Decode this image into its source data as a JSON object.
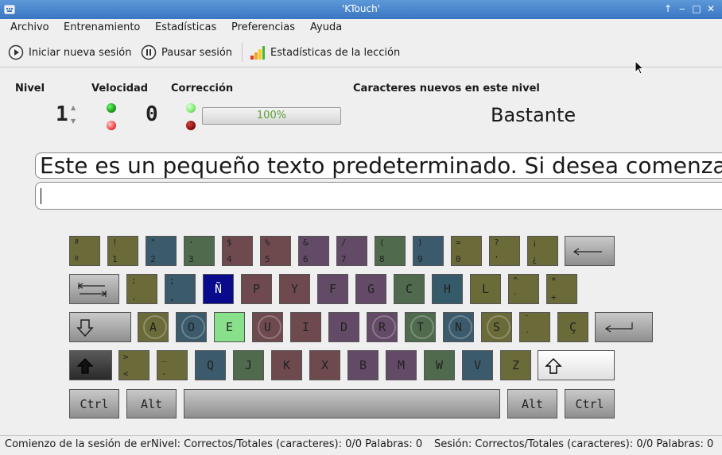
{
  "window": {
    "title": "'KTouch'"
  },
  "menu": [
    {
      "label": "Archivo"
    },
    {
      "label": "Entrenamiento"
    },
    {
      "label": "Estadísticas"
    },
    {
      "label": "Preferencias"
    },
    {
      "label": "Ayuda"
    }
  ],
  "toolbar": {
    "new_session": "Iniciar nueva sesión",
    "pause_session": "Pausar sesión",
    "lesson_stats": "Estadísticas de la lección"
  },
  "stats": {
    "level_label": "Nivel",
    "level_value": "1",
    "speed_label": "Velocidad",
    "speed_value": "0",
    "correction_label": "Corrección",
    "correction_percent": "100%",
    "new_chars_label": "Caracteres nuevos en este nivel",
    "new_chars_value": "Bastante",
    "colors": {
      "led_green": "#1f9a1f",
      "led_red": "#e44",
      "led_light_green": "#7dea6e",
      "led_dark_red": "#8a1010"
    }
  },
  "text": {
    "teacher_line": "Este es un pequeño texto predeterminado. Si desea comenzar",
    "student_line": ""
  },
  "keyboard": {
    "row1": [
      {
        "top": "ª",
        "bottom": "º"
      },
      {
        "top": "!",
        "bottom": "1"
      },
      {
        "top": "\"",
        "bottom": "2"
      },
      {
        "top": "·",
        "bottom": "3"
      },
      {
        "top": "$",
        "bottom": "4"
      },
      {
        "top": "%",
        "bottom": "5"
      },
      {
        "top": "&",
        "bottom": "6"
      },
      {
        "top": "/",
        "bottom": "7"
      },
      {
        "top": "(",
        "bottom": "8"
      },
      {
        "top": ")",
        "bottom": "9"
      },
      {
        "top": "=",
        "bottom": "0"
      },
      {
        "top": "?",
        "bottom": "'"
      },
      {
        "top": "¡",
        "bottom": "¿"
      }
    ],
    "row2": [
      {
        "top": ":",
        "bottom": "."
      },
      {
        "top": ";",
        "bottom": ","
      },
      {
        "main": "Ñ"
      },
      {
        "main": "P"
      },
      {
        "main": "Y"
      },
      {
        "main": "F"
      },
      {
        "main": "G"
      },
      {
        "main": "C"
      },
      {
        "main": "H"
      },
      {
        "main": "L"
      },
      {
        "top": "^",
        "bottom": "`"
      },
      {
        "top": "*",
        "bottom": "+"
      }
    ],
    "row3": [
      {
        "main": "A"
      },
      {
        "main": "O"
      },
      {
        "main": "E"
      },
      {
        "main": "U"
      },
      {
        "main": "I"
      },
      {
        "main": "D"
      },
      {
        "main": "R"
      },
      {
        "main": "T"
      },
      {
        "main": "N"
      },
      {
        "main": "S"
      },
      {
        "top": "¨",
        "bottom": "´"
      },
      {
        "main": "Ç"
      }
    ],
    "row4": [
      {
        "top": ">",
        "bottom": "<"
      },
      {
        "top": "_",
        "bottom": "-"
      },
      {
        "main": "Q"
      },
      {
        "main": "J"
      },
      {
        "main": "K"
      },
      {
        "main": "X"
      },
      {
        "main": "B"
      },
      {
        "main": "M"
      },
      {
        "main": "W"
      },
      {
        "main": "V"
      },
      {
        "main": "Z"
      }
    ],
    "ctrl_left": "Ctrl",
    "alt_left": "Alt",
    "alt_right": "Alt",
    "ctrl_right": "Ctrl"
  },
  "statusbar": {
    "message": "Comienzo de la sesión de entrenamiento",
    "level": "Nivel:  Correctos/Totales (caracteres): 0/0  Palabras: 0",
    "session": "Sesión:  Correctos/Totales (caracteres): 0/0  Palabras: 0"
  }
}
